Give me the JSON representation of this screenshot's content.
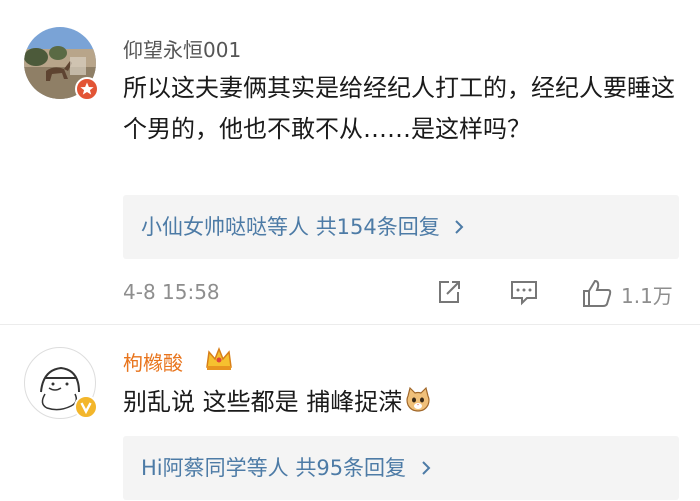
{
  "comments": [
    {
      "username": "仰望永恒001",
      "content": "所以这夫妻俩其实是给经纪人打工的，经纪人要睡这个男的，他也不敢不从……是这样吗？",
      "replies": {
        "names": "小仙女帅哒哒",
        "deng": "等人",
        "total": "共154条回复"
      },
      "timestamp": "4-8 15:58",
      "likes": "1.1万",
      "badge_icon": "red-star-badge-icon"
    },
    {
      "username": "枸橼酸",
      "content": "别乱说 这些都是 捕峰捉溁",
      "emoji_icon": "cat-face-emoji-icon",
      "crown_icon": "crown-vip-icon",
      "replies": {
        "names": "Hi阿蔡同学",
        "deng": "等人",
        "total": "共95条回复"
      },
      "badge_icon": "yellow-v-badge-icon"
    }
  ],
  "colors": {
    "username_gray": "#555555",
    "username_orange": "#e8741c",
    "link_blue": "#4d7ba6",
    "meta_gray": "#8e8e8e",
    "reply_bg": "#f4f4f4"
  }
}
